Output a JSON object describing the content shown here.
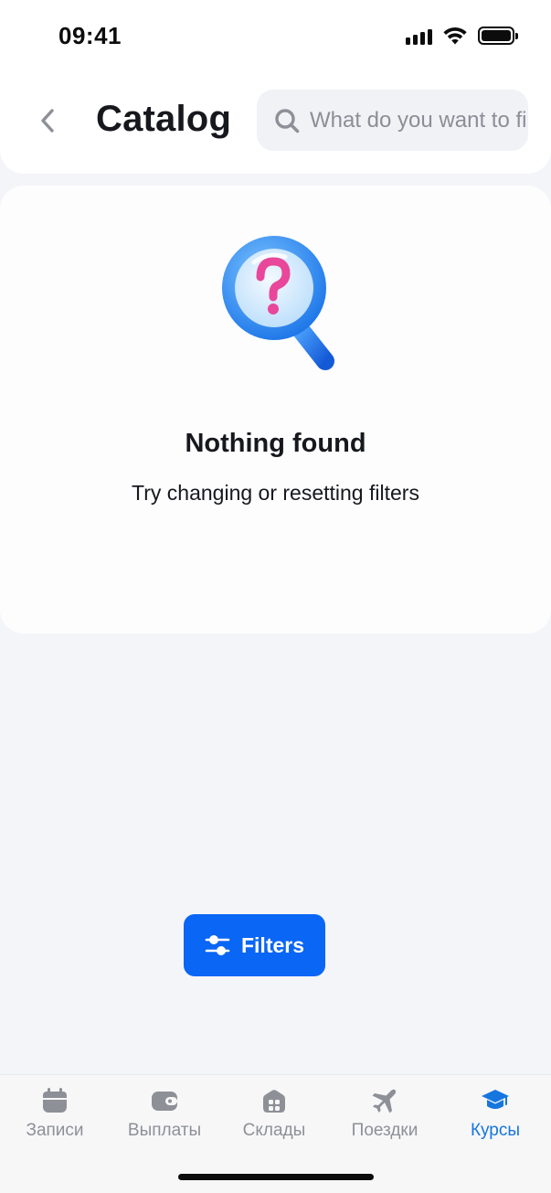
{
  "status_bar": {
    "time": "09:41"
  },
  "header": {
    "title": "Catalog",
    "back_icon": "chevron-left-icon"
  },
  "search": {
    "placeholder": "What do you want to find?",
    "value": "",
    "icon": "search-icon"
  },
  "empty_state": {
    "illustration": "magnifier-question-icon",
    "title": "Nothing found",
    "subtitle": "Try changing or resetting filters"
  },
  "filters_button": {
    "label": "Filters",
    "icon": "sliders-icon"
  },
  "tab_bar": {
    "active_color": "#1676e0",
    "inactive_color": "#8e9098",
    "items": [
      {
        "label": "Записи",
        "icon": "calendar-icon",
        "active": false
      },
      {
        "label": "Выплаты",
        "icon": "wallet-icon",
        "active": false
      },
      {
        "label": "Склады",
        "icon": "warehouse-icon",
        "active": false
      },
      {
        "label": "Поездки",
        "icon": "airplane-icon",
        "active": false
      },
      {
        "label": "Курсы",
        "icon": "graduation-cap-icon",
        "active": true
      }
    ]
  },
  "colors": {
    "accent": "#0a66f5",
    "background": "#f4f5f9",
    "card": "#fdfdfe",
    "text": "#16181d"
  }
}
